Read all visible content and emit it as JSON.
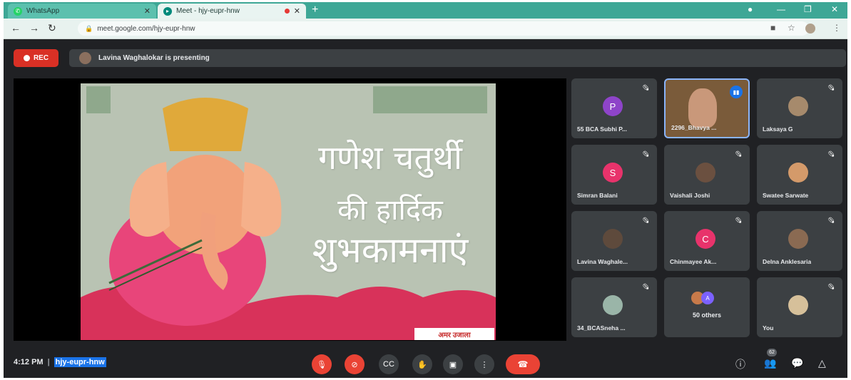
{
  "browser": {
    "tabs": [
      {
        "label": "WhatsApp"
      },
      {
        "label": "Meet - hjy-eupr-hnw"
      }
    ],
    "url": "meet.google.com/hjy-eupr-hnw"
  },
  "meet": {
    "rec_label": "REC",
    "presenting_text": "Lavina Waghalokar is presenting",
    "slide": {
      "line1": "गणेश चतुर्थी",
      "line2": "की हार्दिक",
      "line3": "शुभकामनाएं",
      "logo": "अमर उजाला"
    },
    "participants": [
      {
        "name": "55 BCA Subhi P...",
        "initial": "P",
        "color": "#8e44c9"
      },
      {
        "name": "2296_Bhavya ...",
        "speaking": true
      },
      {
        "name": "Laksaya G"
      },
      {
        "name": "Simran Balani",
        "initial": "S",
        "color": "#e8336b"
      },
      {
        "name": "Vaishali Joshi"
      },
      {
        "name": "Swatee Sarwate"
      },
      {
        "name": "Lavina Waghale..."
      },
      {
        "name": "Chinmayee Ak...",
        "initial": "C",
        "color": "#e8336b"
      },
      {
        "name": "Delna Anklesaria"
      },
      {
        "name": "34_BCASneha ..."
      },
      {
        "name": "50 others",
        "initial": "A",
        "color": "#7b61ff"
      },
      {
        "name": "You"
      }
    ],
    "time": "4:12 PM",
    "meeting_code": "hjy-eupr-hnw",
    "people_count": "62",
    "colors": {
      "accent": "#1a73e8",
      "danger": "#ea4335",
      "tile_bg": "#3c4043",
      "chrome": "#3ea796"
    }
  }
}
